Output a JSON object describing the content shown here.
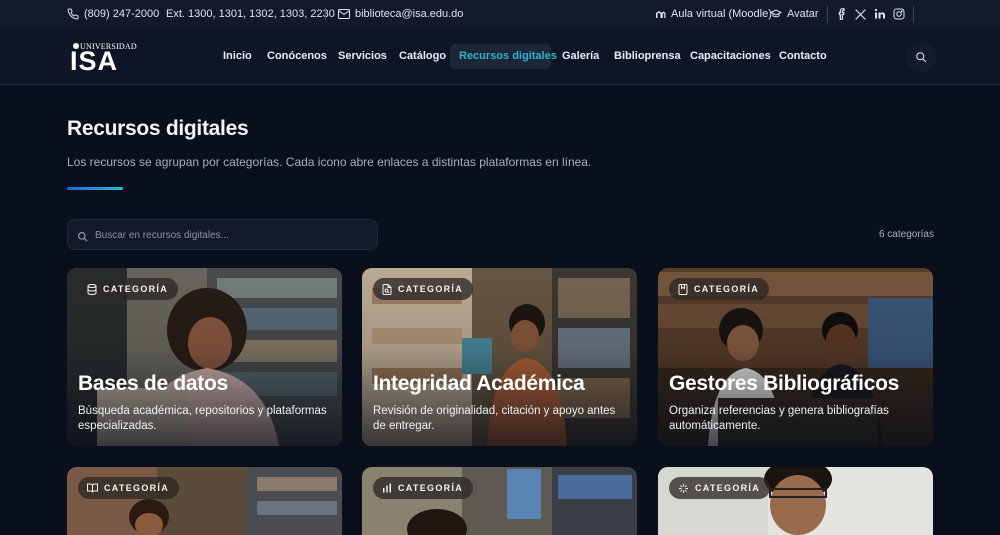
{
  "topbar": {
    "phone": "(809) 247-2000",
    "extensions": "Ext. 1300, 1301, 1302, 1303, 2230",
    "email": "biblioteca@isa.edu.do",
    "aula": "Aula virtual (Moodle)",
    "avatar": "Avatar",
    "icons": [
      "phone-icon",
      "mail-icon",
      "moodle-icon",
      "avatar-icon",
      "facebook-icon",
      "x-icon",
      "linkedin-icon",
      "instagram-icon"
    ]
  },
  "logo": {
    "top": "UNIVERSIDAD",
    "main": "ISA"
  },
  "nav": {
    "items": [
      "Inicio",
      "Conócenos",
      "Servicios",
      "Catálogo",
      "Recursos digitales",
      "Galería",
      "Biblioprensa",
      "Capacitaciones",
      "Contacto"
    ],
    "active": "Recursos digitales",
    "accent_color": "#2fb3c7"
  },
  "hero": {
    "title": "Recursos digitales",
    "subtitle": "Los recursos se agrupan por categorías. Cada icono abre enlaces a distintas plataformas en línea."
  },
  "search": {
    "placeholder": "Buscar en recursos digitales...",
    "value": ""
  },
  "count": "6 categorías",
  "cards": [
    {
      "badge": "CATEGORÍA",
      "icon": "database-icon",
      "title": "Bases de datos",
      "desc": "Búsqueda académica, repositorios y plataformas especializadas."
    },
    {
      "badge": "CATEGORÍA",
      "icon": "integrity-icon",
      "title": "Integridad Académica",
      "desc": "Revisión de originalidad, citación y apoyo antes de entregar."
    },
    {
      "badge": "CATEGORÍA",
      "icon": "bookmark-icon",
      "title": "Gestores Bibliográficos",
      "desc": "Organiza referencias y genera bibliografías automáticamente."
    },
    {
      "badge": "CATEGORÍA",
      "icon": "book-icon",
      "title": "",
      "desc": ""
    },
    {
      "badge": "CATEGORÍA",
      "icon": "chart-icon",
      "title": "",
      "desc": ""
    },
    {
      "badge": "CATEGORÍA",
      "icon": "sparkle-icon",
      "title": "",
      "desc": ""
    }
  ]
}
